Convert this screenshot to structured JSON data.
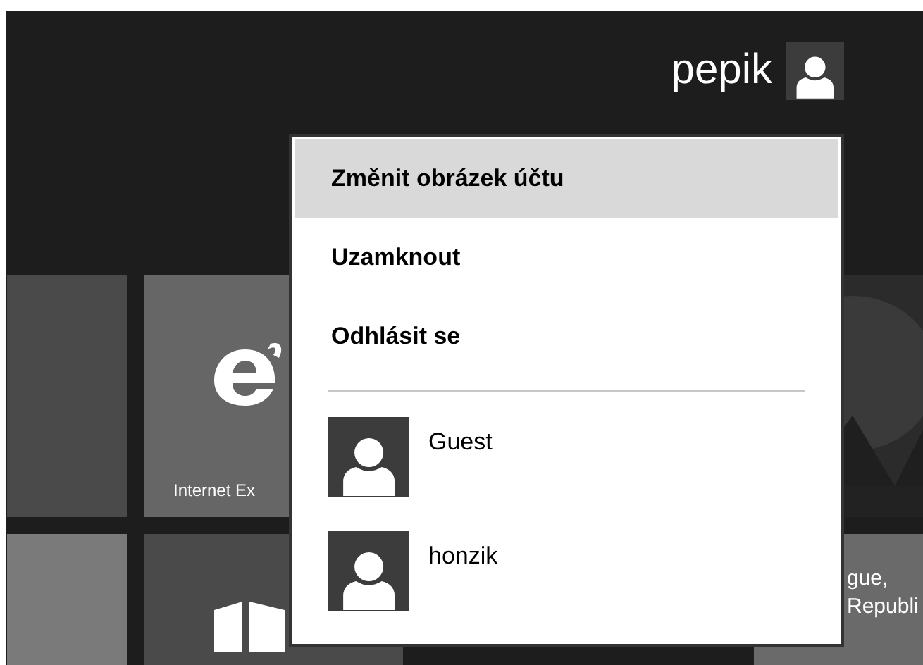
{
  "header": {
    "user_name": "pepik"
  },
  "account_menu": {
    "items": [
      {
        "label": "Změnit obrázek účtu",
        "selected": true
      },
      {
        "label": "Uzamknout",
        "selected": false
      },
      {
        "label": "Odhlásit se",
        "selected": false
      }
    ],
    "other_accounts": [
      {
        "name": "Guest"
      },
      {
        "name": "honzik"
      }
    ]
  },
  "tiles": [
    {
      "kind": "dark"
    },
    {
      "kind": "browser",
      "label": "Internet Ex"
    },
    {
      "kind": "picture"
    },
    {
      "kind": "light"
    },
    {
      "kind": "store"
    },
    {
      "kind": "place",
      "lines": [
        "gue,",
        "Republi"
      ]
    }
  ]
}
